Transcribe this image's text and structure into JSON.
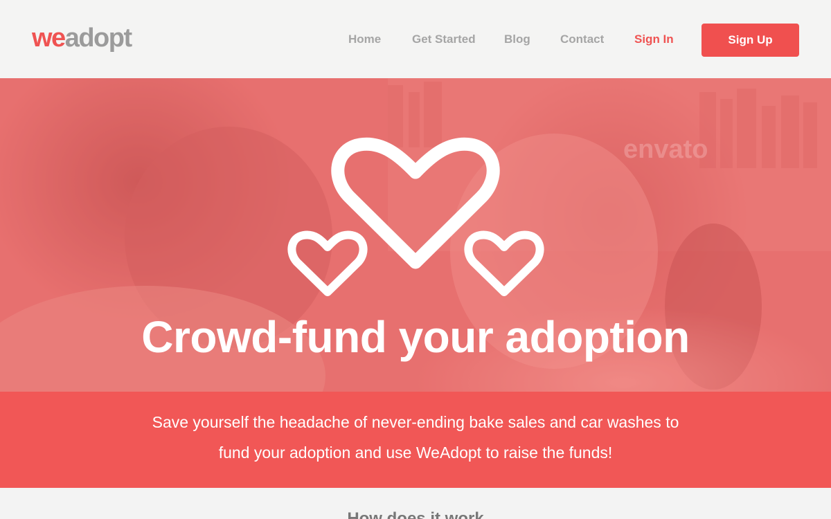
{
  "brand": {
    "logo_we": "we",
    "logo_adopt": "adopt",
    "primary_color": "#ef5352",
    "secondary_color": "#9b9b9b"
  },
  "nav": {
    "items": [
      {
        "label": "Home"
      },
      {
        "label": "Get Started"
      },
      {
        "label": "Blog"
      },
      {
        "label": "Contact"
      }
    ],
    "sign_in": "Sign In",
    "sign_up": "Sign Up"
  },
  "hero": {
    "icon": "three-hearts-icon",
    "title": "Crowd-fund your adoption",
    "watermark": "envato"
  },
  "band": {
    "line1": "Save yourself the headache of never-ending bake sales and car washes to",
    "line2": "fund your adoption and use WeAdopt to raise the funds!",
    "color": "#f15756"
  },
  "next_section": {
    "heading": "How does it work"
  }
}
